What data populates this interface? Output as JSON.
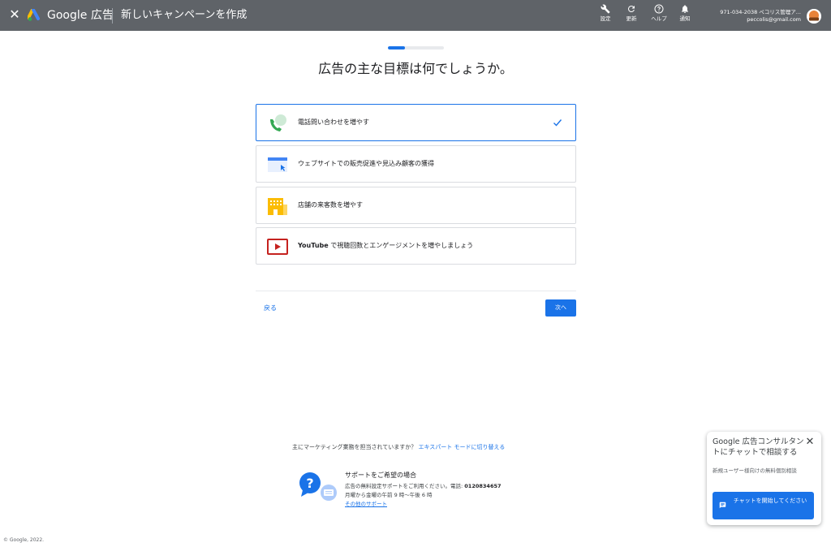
{
  "header": {
    "brand": "Google 広告",
    "page_title": "新しいキャンペーンを作成",
    "tools": [
      {
        "label": "設定",
        "icon": "wrench-icon"
      },
      {
        "label": "更新",
        "icon": "refresh-icon"
      },
      {
        "label": "ヘルプ",
        "icon": "help-icon"
      },
      {
        "label": "通知",
        "icon": "bell-icon"
      }
    ],
    "account": {
      "id_name": "971-034-2038 ペコリス管理ア...",
      "email": "peccolis@gmail.com"
    }
  },
  "progress": {
    "fraction": 0.3
  },
  "main": {
    "question": "広告の主な目標は何でしょうか。",
    "goals": [
      {
        "label": "電話問い合わせを増やす",
        "icon": "phone-call-icon",
        "selected": true
      },
      {
        "label": "ウェブサイトでの販売促進や見込み顧客の獲得",
        "icon": "website-icon",
        "selected": false
      },
      {
        "label": "店舗の来客数を増やす",
        "icon": "store-icon",
        "selected": false
      },
      {
        "label": "で視聴回数とエンゲージメントを増やしましょう",
        "label_strong": "YouTube",
        "icon": "youtube-icon",
        "selected": false
      }
    ],
    "back_label": "戻る",
    "next_label": "次へ"
  },
  "footer": {
    "expert_text": "主にマーケティング業務を担当されていますか？",
    "expert_link": "エキスパート モードに切り替える",
    "support_title": "サポートをご希望の場合",
    "support_desc": "広告の無料設定サポートをご利用ください。電話:",
    "support_phone": "0120834657",
    "support_hours": "月曜から金曜の午前 9 時〜午後 6 時",
    "support_link": "その他のサポート",
    "copyright": "© Google, 2022."
  },
  "chat": {
    "title": "Google 広告コンサルタントにチャットで相談する",
    "subtitle": "新規ユーザー様向けの無料個別相談",
    "button_label": "チャットを開始してください"
  },
  "colors": {
    "header_bg": "#5f6368",
    "accent": "#1a73e8",
    "border": "#dadce0"
  }
}
